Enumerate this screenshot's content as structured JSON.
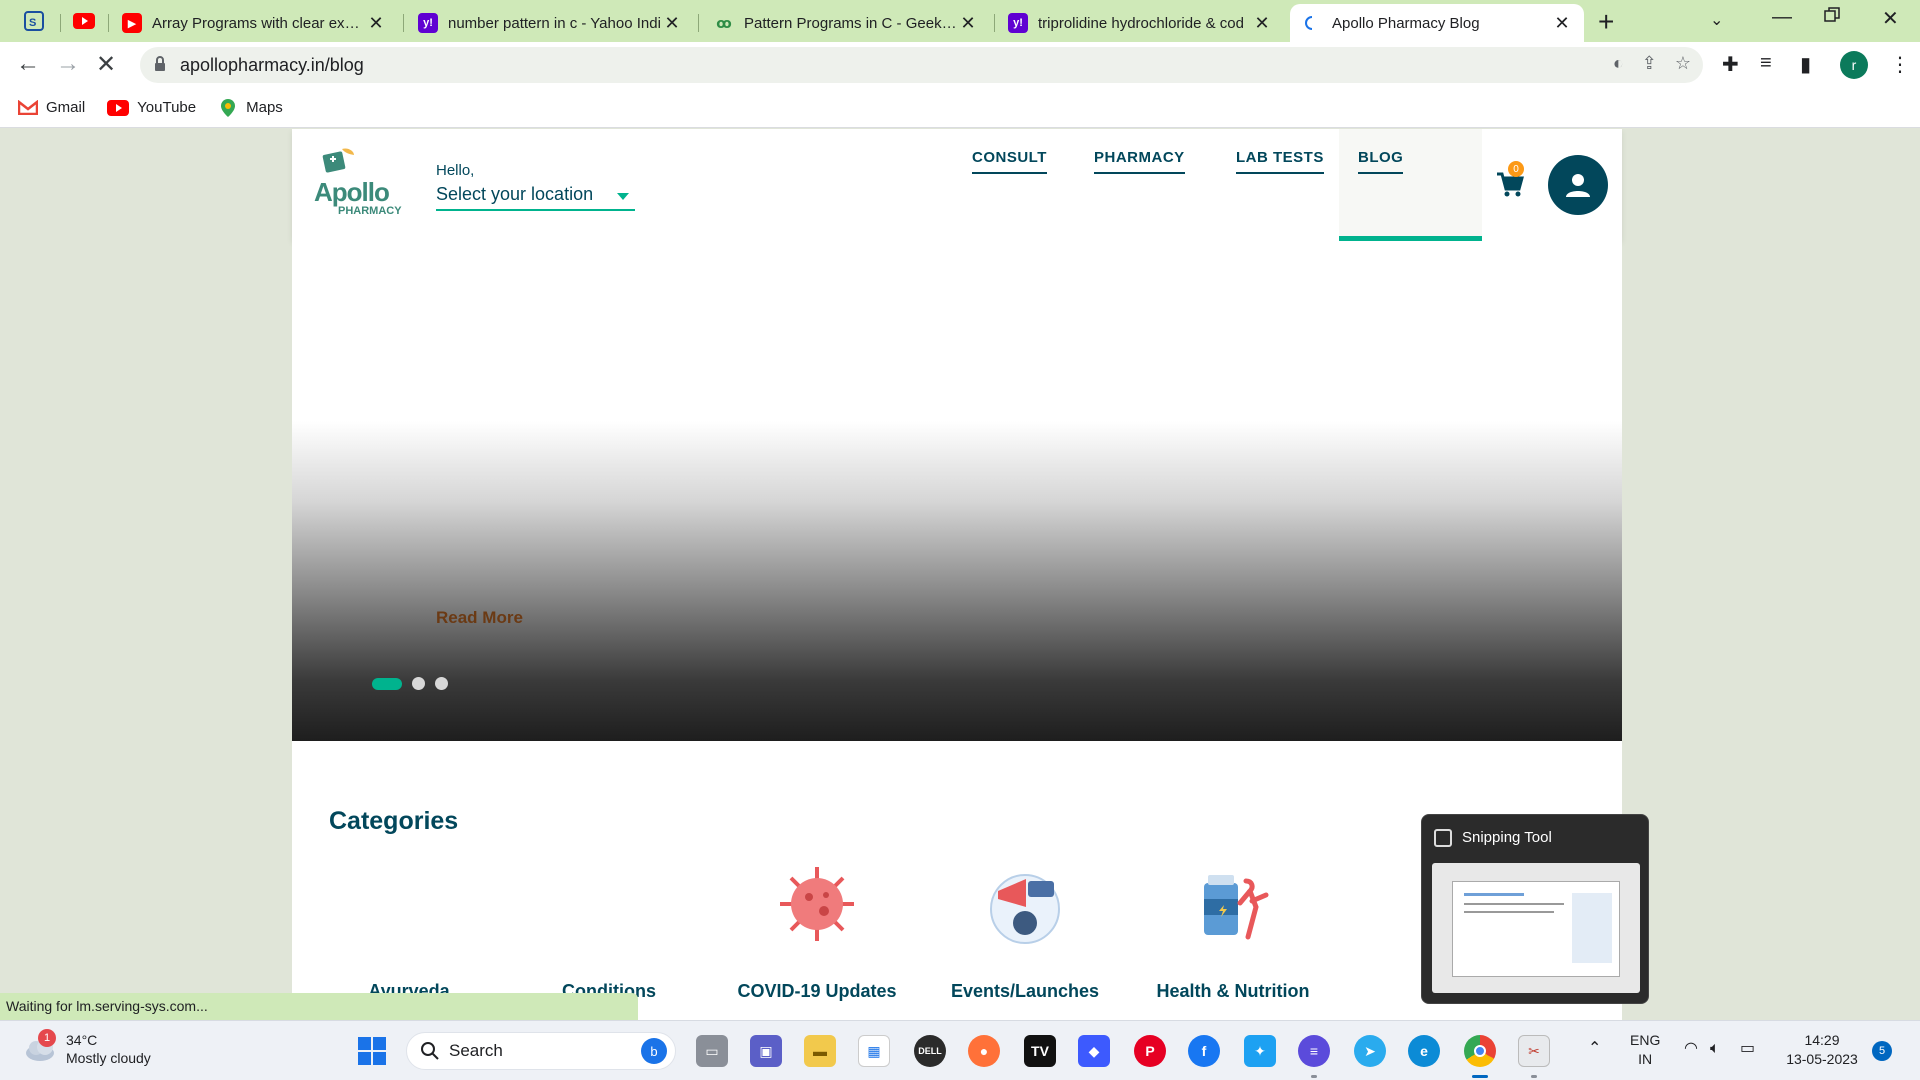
{
  "browser": {
    "tabs": [
      {
        "title": "Array Programs with clear explar",
        "favicon": "youtube-icon",
        "color": "#ff0000"
      },
      {
        "title": "number pattern in c - Yahoo Indi",
        "favicon": "yahoo-icon",
        "color": "#6001d2"
      },
      {
        "title": "Pattern Programs in C - Geeksfor",
        "favicon": "geeksforgeeks-icon",
        "color": "#2f8d46"
      },
      {
        "title": "triprolidine hydrochloride & cod",
        "favicon": "yahoo-icon",
        "color": "#6001d2"
      },
      {
        "title": "Apollo Pharmacy Blog",
        "favicon": "loading-icon",
        "color": "#1a73e8"
      }
    ],
    "url": "apollopharmacy.in/blog",
    "profile_initial": "r",
    "bookmarks": [
      {
        "label": "Gmail",
        "icon": "gmail-icon"
      },
      {
        "label": "YouTube",
        "icon": "youtube-icon"
      },
      {
        "label": "Maps",
        "icon": "maps-icon"
      }
    ],
    "status": "Waiting for lm.serving-sys.com..."
  },
  "site": {
    "logo": {
      "word": "Apollo",
      "sub": "PHARMACY"
    },
    "greeting": "Hello,",
    "location_placeholder": "Select your location",
    "nav": [
      "CONSULT",
      "PHARMACY",
      "LAB TESTS",
      "BLOG"
    ],
    "active_nav": "BLOG",
    "cart_count": "0",
    "hero": {
      "read_more": "Read More",
      "slides": 3,
      "active_slide": 1
    },
    "categories": {
      "title": "Categories",
      "items": [
        {
          "label": "Ayurveda",
          "icon": ""
        },
        {
          "label": "Conditions",
          "icon": ""
        },
        {
          "label": "COVID-19 Updates",
          "icon": "virus-icon"
        },
        {
          "label": "Events/Launches",
          "icon": "megaphone-icon"
        },
        {
          "label": "Health & Nutrition",
          "icon": "nutrition-icon"
        }
      ]
    }
  },
  "snipping_tool": {
    "title": "Snipping Tool"
  },
  "taskbar": {
    "weather": {
      "temp": "34°C",
      "desc": "Mostly cloudy",
      "badge": "1"
    },
    "search_label": "Search",
    "lang": {
      "line1": "ENG",
      "line2": "IN"
    },
    "clock": {
      "time": "14:29",
      "date": "13-05-2023"
    },
    "notifications": "5"
  },
  "colors": {
    "brand_teal": "#02475b",
    "accent_green": "#00b38e",
    "tabstrip": "#cfe9b8"
  }
}
